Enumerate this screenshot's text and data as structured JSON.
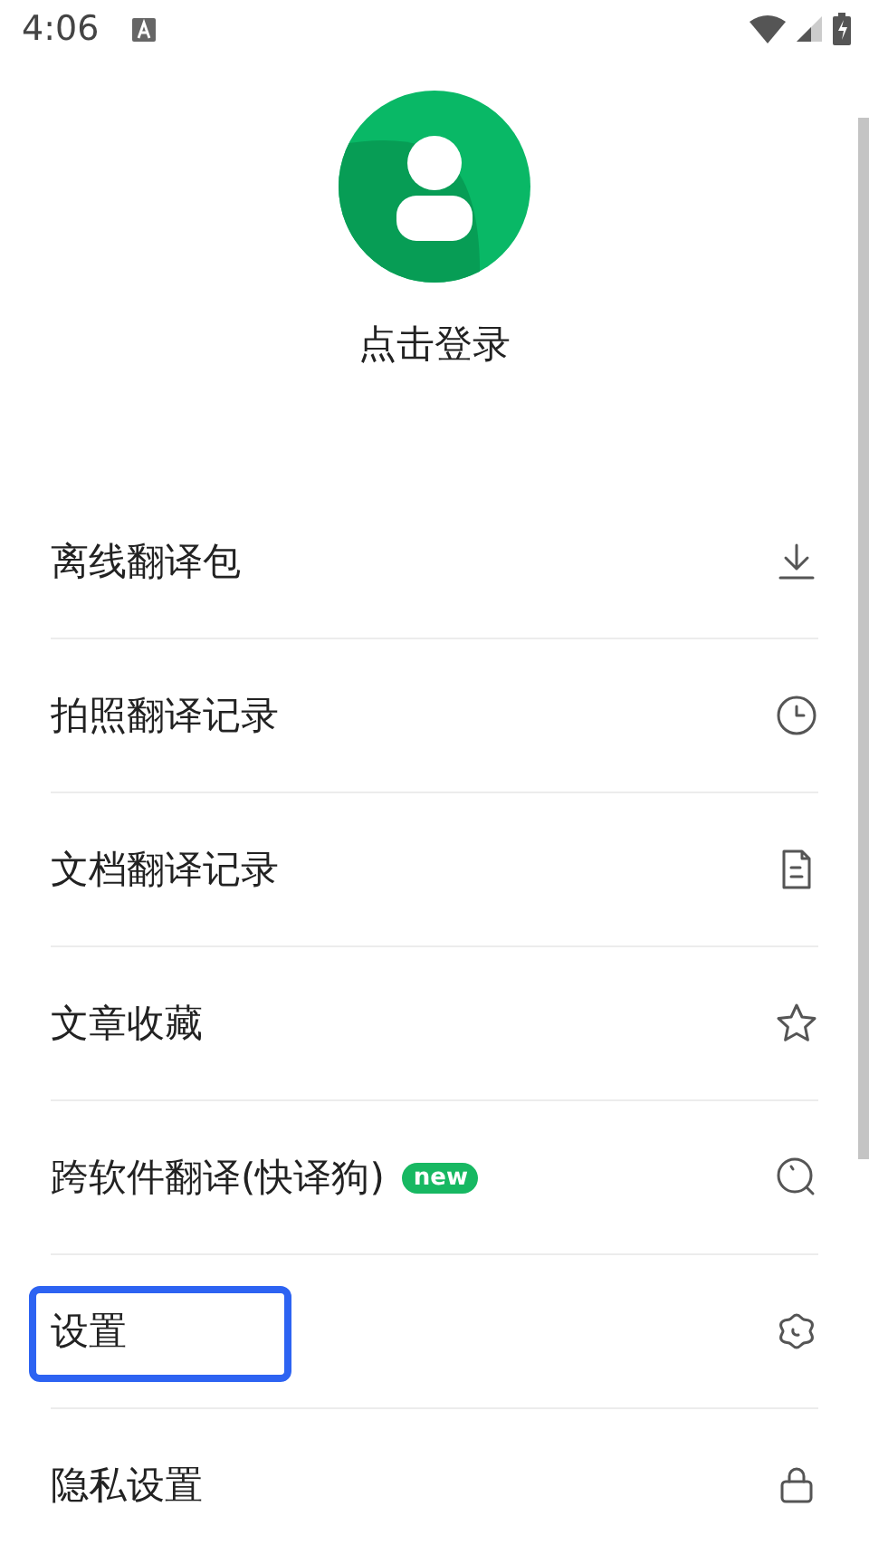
{
  "status_bar": {
    "time": "4:06"
  },
  "profile": {
    "login_label": "点击登录"
  },
  "menu": [
    {
      "label": "离线翻译包",
      "highlighted": false
    },
    {
      "label": "拍照翻译记录",
      "highlighted": false
    },
    {
      "label": "文档翻译记录",
      "highlighted": false
    },
    {
      "label": "文章收藏",
      "highlighted": false
    },
    {
      "label": "跨软件翻译(快译狗)",
      "badge": "new",
      "highlighted": false
    },
    {
      "label": "设置",
      "highlighted": true
    },
    {
      "label": "隐私设置",
      "highlighted": false
    }
  ]
}
